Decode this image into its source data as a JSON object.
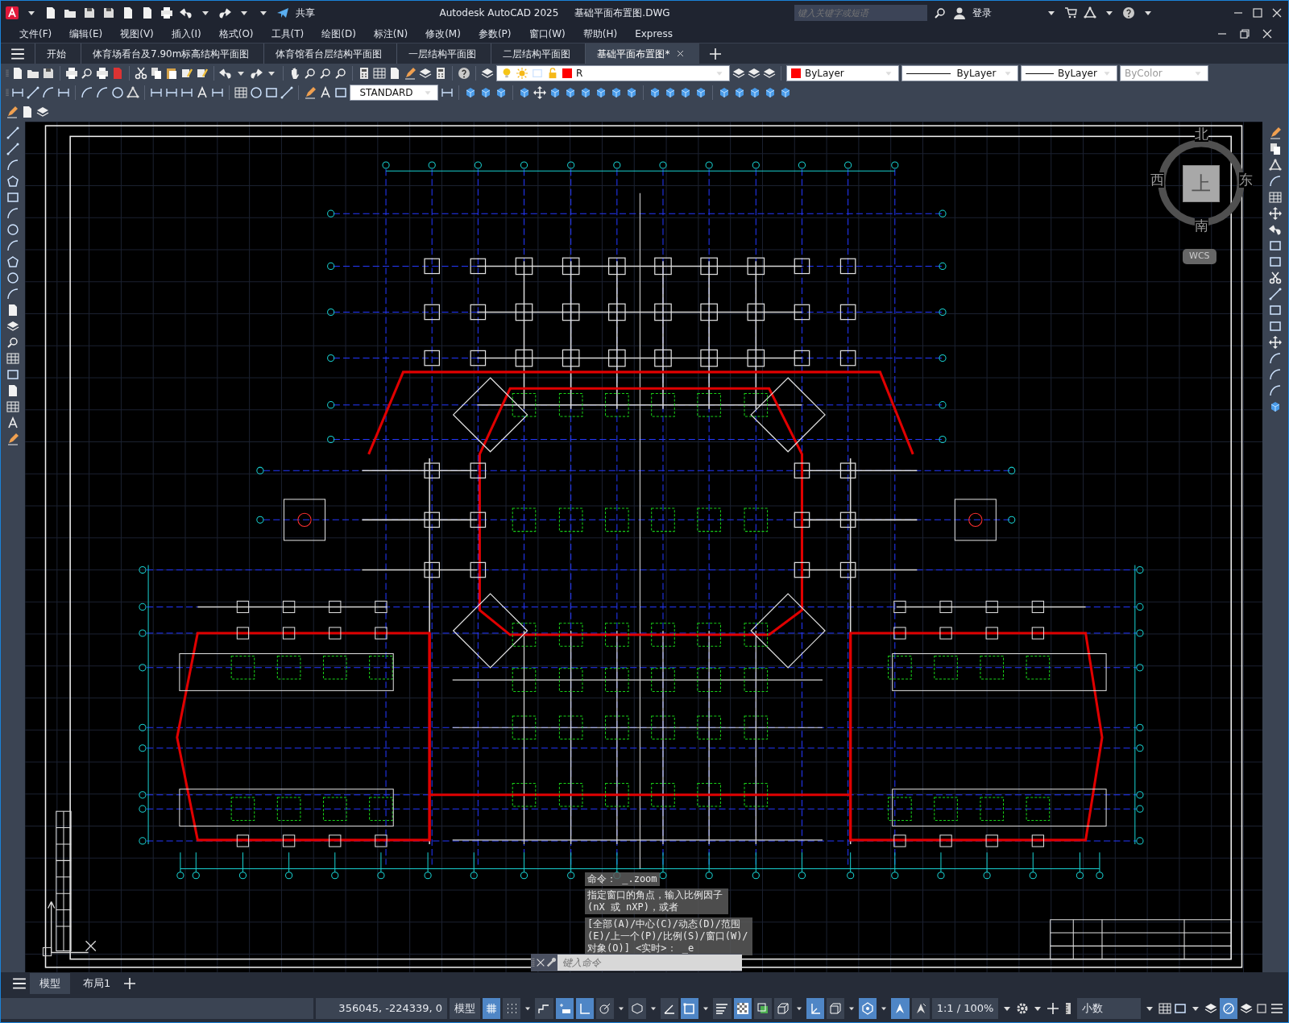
{
  "title_bar": {
    "app_title": "Autodesk AutoCAD 2025",
    "file_name": "基础平面布置图.DWG",
    "share_label": "共享",
    "search": {
      "placeholder": "键入关键字或短语"
    },
    "sign_in": "登录"
  },
  "menu": [
    "文件(F)",
    "编辑(E)",
    "视图(V)",
    "插入(I)",
    "格式(O)",
    "工具(T)",
    "绘图(D)",
    "标注(N)",
    "修改(M)",
    "参数(P)",
    "窗口(W)",
    "帮助(H)",
    "Express"
  ],
  "file_tabs": [
    {
      "label": "开始",
      "selected": false
    },
    {
      "label": "体育场看台及7.90m标高结构平面图",
      "selected": false
    },
    {
      "label": "体育馆看台层结构平面图",
      "selected": false
    },
    {
      "label": "一层结构平面图",
      "selected": false
    },
    {
      "label": "二层结构平面图",
      "selected": false
    },
    {
      "label": "基础平面布置图*",
      "selected": true
    }
  ],
  "toolbars": {
    "layer": {
      "name": "R",
      "color": "#ff0000"
    },
    "color_control": {
      "value": "ByLayer",
      "color": "#ff0000"
    },
    "linetype": "ByLayer",
    "lineweight": "ByLayer",
    "plot_style": {
      "value": "ByColor",
      "disabled": true
    },
    "text_style": "STANDARD"
  },
  "viewcube": {
    "north": "北",
    "west": "西",
    "east": "东",
    "south": "南",
    "face": "上",
    "coordinate_system": "WCS"
  },
  "command_history": [
    "命令：  _.zoom",
    "指定窗口的角点，输入比例因子 (nX 或 nXP)，或者",
    "[全部(A)/中心(C)/动态(D)/范围(E)/上一个(P)/比例(S)/窗口(W)/对象(O)] <实时>： _e"
  ],
  "command_line": {
    "placeholder": "键入命令"
  },
  "layout_tabs": [
    {
      "label": "模型",
      "selected": true
    },
    {
      "label": "布局1",
      "selected": false
    }
  ],
  "status_bar": {
    "coordinates": "356045, -224339, 0",
    "space": "模型",
    "toggles": [
      {
        "kind": "grid",
        "on": true
      },
      {
        "kind": "snap",
        "on": false
      },
      {
        "kind": "infer",
        "on": false
      },
      {
        "kind": "snapmode",
        "on": true
      },
      {
        "kind": "ortho",
        "on": true
      },
      {
        "kind": "polar",
        "on": false
      },
      {
        "kind": "isodraft",
        "on": false
      },
      {
        "kind": "tracking",
        "on": false
      },
      {
        "kind": "osnap",
        "on": true
      },
      {
        "kind": "lineweight",
        "on": false
      },
      {
        "kind": "transparency",
        "on": true
      },
      {
        "kind": "cycling",
        "on": false
      },
      {
        "kind": "osnap3d",
        "on": false
      },
      {
        "kind": "ducs",
        "on": true
      },
      {
        "kind": "filter",
        "on": false
      },
      {
        "kind": "gizmo",
        "on": true
      },
      {
        "kind": "annotation",
        "on": true
      },
      {
        "kind": "autoscale",
        "on": false
      }
    ],
    "annotation_scale": "1:1 / 100%",
    "units": "小数",
    "hardware_acceleration": {
      "on": true
    }
  }
}
